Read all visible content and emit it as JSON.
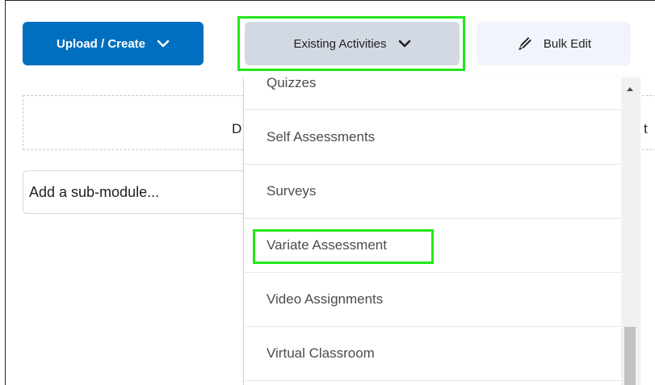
{
  "toolbar": {
    "upload_create_label": "Upload / Create",
    "existing_activities_label": "Existing Activities",
    "bulk_edit_label": "Bulk Edit"
  },
  "dropzone": {
    "text_left": "D",
    "text_right": "t"
  },
  "submodule": {
    "placeholder": "Add a sub-module..."
  },
  "menu": {
    "items": [
      {
        "label": "Quizzes"
      },
      {
        "label": "Self Assessments"
      },
      {
        "label": "Surveys"
      },
      {
        "label": "Variate Assessment"
      },
      {
        "label": "Video Assignments"
      },
      {
        "label": "Virtual Classroom"
      }
    ],
    "highlighted_item": "Variate Assessment"
  },
  "colors": {
    "primary": "#006fbf",
    "secondary_button": "#d3d9e3",
    "highlight": "#23e61b"
  },
  "icons": {
    "dropdown": "chevron-down-icon",
    "bulk_edit": "pencil-icon"
  }
}
